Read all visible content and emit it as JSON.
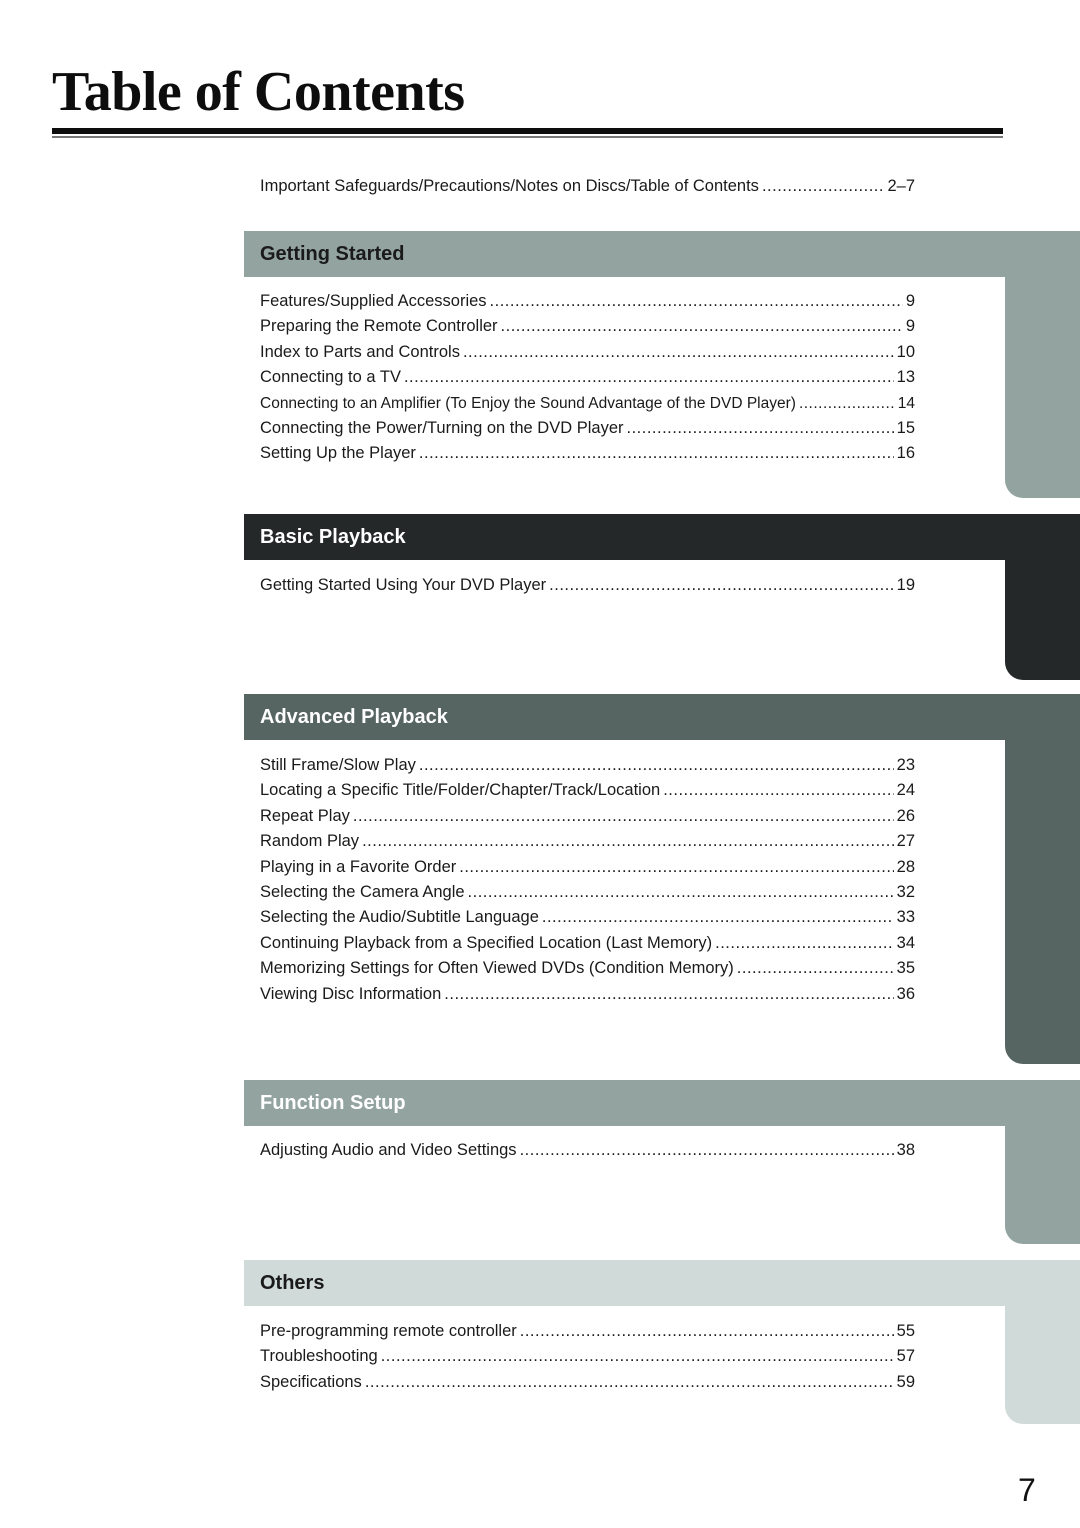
{
  "page": {
    "title": "Table of Contents",
    "page_number": "7"
  },
  "intro": {
    "label": "Important Safeguards/Precautions/Notes on Discs/Table of Contents",
    "page": "2–7"
  },
  "sections": [
    {
      "title": "Getting Started",
      "color": "#93a3a0",
      "title_color": "#1a1a1a",
      "entries": [
        {
          "label": "Features/Supplied Accessories",
          "page": "9"
        },
        {
          "label": "Preparing the Remote Controller",
          "page": "9"
        },
        {
          "label": "Index to Parts and Controls",
          "page": "10"
        },
        {
          "label": "Connecting to a TV",
          "page": "13"
        },
        {
          "label": "Connecting to an Amplifier (To Enjoy the Sound Advantage of the DVD Player)",
          "page": "14"
        },
        {
          "label": "Connecting the Power/Turning on the DVD Player",
          "page": "15"
        },
        {
          "label": "Setting Up the Player",
          "page": "16"
        }
      ]
    },
    {
      "title": "Basic Playback",
      "color": "#242829",
      "title_color": "#ffffff",
      "entries": [
        {
          "label": "Getting Started Using Your DVD Player",
          "page": "19"
        }
      ]
    },
    {
      "title": "Advanced Playback",
      "color": "#566462",
      "title_color": "#ffffff",
      "entries": [
        {
          "label": "Still Frame/Slow Play",
          "page": "23"
        },
        {
          "label": "Locating a Specific Title/Folder/Chapter/Track/Location",
          "page": "24"
        },
        {
          "label": "Repeat Play",
          "page": "26"
        },
        {
          "label": "Random Play",
          "page": "27"
        },
        {
          "label": "Playing in a Favorite Order",
          "page": "28"
        },
        {
          "label": "Selecting the Camera Angle",
          "page": "32"
        },
        {
          "label": "Selecting the Audio/Subtitle Language",
          "page": "33"
        },
        {
          "label": "Continuing Playback from a Specified Location (Last Memory)",
          "page": "34"
        },
        {
          "label": "Memorizing Settings for Often Viewed DVDs (Condition Memory)",
          "page": "35"
        },
        {
          "label": "Viewing Disc Information",
          "page": "36"
        }
      ]
    },
    {
      "title": "Function Setup",
      "color": "#93a3a0",
      "title_color": "#ffffff",
      "entries": [
        {
          "label": "Adjusting Audio and Video Settings",
          "page": "38"
        }
      ]
    },
    {
      "title": "Others",
      "color": "#d0dad8",
      "title_color": "#1a1a1a",
      "entries": [
        {
          "label": "Pre-programming remote controller",
          "page": "55"
        },
        {
          "label": "Troubleshooting",
          "page": "57"
        },
        {
          "label": "Specifications",
          "page": "59"
        }
      ]
    }
  ]
}
